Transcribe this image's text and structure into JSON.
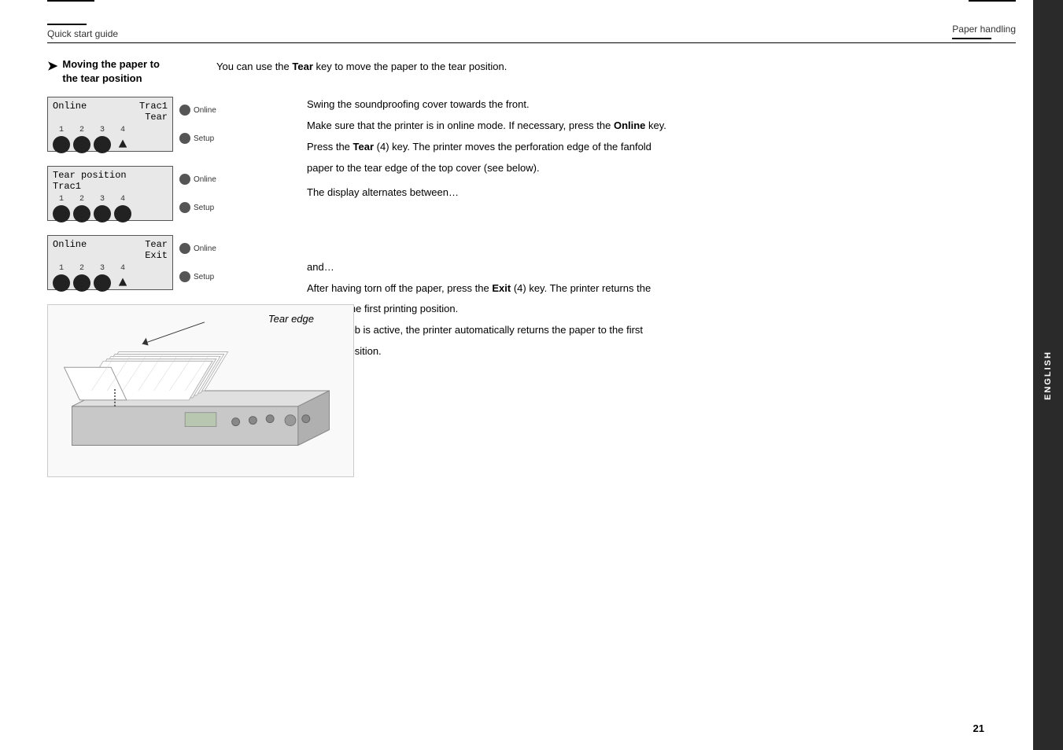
{
  "header": {
    "left": "Quick start guide",
    "right": "Paper handling"
  },
  "sidebar": {
    "label": "ENGLISH"
  },
  "section": {
    "arrow": "➤",
    "heading_line1": "Moving the paper to",
    "heading_line2": "the tear position",
    "intro": "You can use the ",
    "intro_bold": "Tear",
    "intro_rest": " key to move the paper to the tear position."
  },
  "step1": {
    "line1": "Swing the soundproofing cover towards the front.",
    "line2_pre": "Make sure that the printer is in online mode. If necessary, press the ",
    "line2_bold": "Online",
    "line2_post": " key.",
    "line3_pre": "Press the ",
    "line3_bold1": "Tear",
    "line3_mid": " (4) key. The printer moves the perforation edge of the fanfold",
    "line3_end": "paper to the tear edge of the top cover (see below)."
  },
  "display_alternates": "The display alternates between…",
  "and_text": "and…",
  "step2_pre": "After having torn off the paper, press the ",
  "step2_bold": "Exit",
  "step2_mid": " (4) key. The printer returns the",
  "step2_line2": "paper to the first printing position.",
  "step2_line3": "If a print job is active, the printer automatically returns the paper to the first",
  "step2_line4": "printing position.",
  "panel1": {
    "line1": "Online      Trac1",
    "line2": "                Tear",
    "nums": [
      "1",
      "2",
      "3",
      "4"
    ],
    "has_triangle": true
  },
  "panel2": {
    "line1": "Tear position",
    "line2": "Trac1",
    "nums": [
      "1",
      "2",
      "3",
      "4"
    ],
    "has_triangle": false
  },
  "panel3": {
    "line1": "Online      Tear",
    "line2": "                Exit",
    "nums": [
      "1",
      "2",
      "3",
      "4"
    ],
    "has_triangle": true
  },
  "side_buttons": {
    "online": "Online",
    "setup": "Setup"
  },
  "tear_edge": {
    "label": "Tear edge"
  },
  "page_number": "21"
}
